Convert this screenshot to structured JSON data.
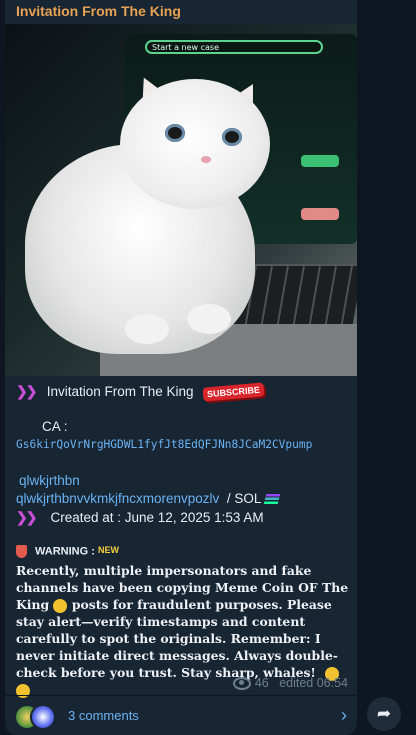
{
  "post": {
    "sender": "Invitation From The King",
    "header_line": "Invitation From The King",
    "subscribe_badge": "SUBSCRIBE",
    "ca_label": "CA :",
    "ca_address": "Gs6kirQoVrNrgHGDWL1fyfJt8EdQFJNn8JCaM2CVpump",
    "link1": "qlwkjrthbn",
    "link2": "qlwkjrthbnvvkmkjfncxmorenvpozlv",
    "sol_label": "/ SOL",
    "created_at": "Created at : June 12, 2025 1:53 AM",
    "warning_label": "WARNING :",
    "new_tag": "NEW",
    "body_1": "Recently, multiple impersonators and fake channels have been copying Meme Coin OF The King",
    "body_2": "posts for fraudulent purposes. Please stay alert—verify timestamps and content carefully to spot the originals. Remember: I never initiate direct messages. Always double-check before you trust. Stay sharp, whales!",
    "views": "46",
    "edited": "edited 06:54",
    "comments": "3 comments",
    "photo_search_text": "Start a new case"
  },
  "colors": {
    "background": "#0e1621",
    "bubble": "#182533",
    "sender": "#e8a254",
    "link": "#6ab3f3",
    "chevron": "#c94fd6"
  },
  "icons": [
    "chevron-double-right-icon",
    "shield-warning-icon",
    "crown-icon",
    "eye-icon",
    "share-icon",
    "solana-icon"
  ]
}
